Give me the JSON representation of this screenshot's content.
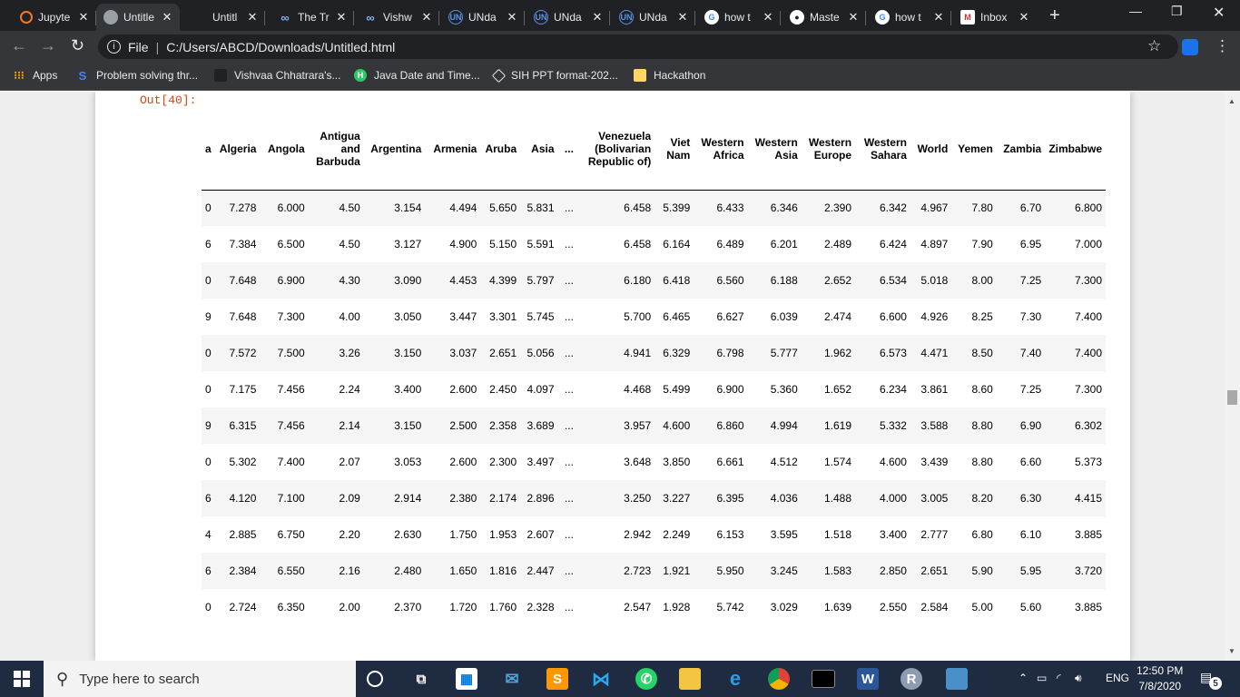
{
  "browser": {
    "tabs": [
      {
        "label": "Jupyte",
        "icon": "jupyter-icon",
        "active": false
      },
      {
        "label": "Untitle",
        "icon": "globe-icon",
        "active": true
      },
      {
        "label": "Untitl",
        "icon": "none",
        "active": false
      },
      {
        "label": "The Tr",
        "icon": "infinity-icon",
        "active": false
      },
      {
        "label": "Vishw",
        "icon": "infinity-icon",
        "active": false
      },
      {
        "label": "UNda",
        "icon": "un-icon",
        "active": false
      },
      {
        "label": "UNda",
        "icon": "un-icon",
        "active": false
      },
      {
        "label": "UNda",
        "icon": "un-icon",
        "active": false
      },
      {
        "label": "how t",
        "icon": "google-icon",
        "active": false
      },
      {
        "label": "Maste",
        "icon": "github-icon",
        "active": false
      },
      {
        "label": "how t",
        "icon": "google-icon",
        "active": false
      },
      {
        "label": "Inbox",
        "icon": "gmail-icon",
        "active": false
      }
    ],
    "address": {
      "scheme": "File",
      "path": "C:/Users/ABCD/Downloads/Untitled.html"
    },
    "bookmarks": [
      {
        "label": "Apps",
        "icon": "apps-grid-icon"
      },
      {
        "label": "Problem solving thr...",
        "icon": "s-logo-icon"
      },
      {
        "label": "Vishvaa Chhatrara's...",
        "icon": "none"
      },
      {
        "label": "Java Date and Time...",
        "icon": "h-logo-icon"
      },
      {
        "label": "SIH PPT format-202...",
        "icon": "sih-icon"
      },
      {
        "label": "Hackathon",
        "icon": "folder-icon"
      }
    ]
  },
  "notebook": {
    "out_prompt": "Out[40]:",
    "columns": [
      "a",
      "Algeria",
      "Angola",
      "Antigua and Barbuda",
      "Argentina",
      "Armenia",
      "Aruba",
      "Asia",
      "...",
      "Venezuela (Bolivarian Republic of)",
      "Viet Nam",
      "Western Africa",
      "Western Asia",
      "Western Europe",
      "Western Sahara",
      "World",
      "Yemen",
      "Zambia",
      "Zimbabwe"
    ],
    "rows": [
      [
        "0",
        "7.278",
        "6.000",
        "4.50",
        "3.154",
        "4.494",
        "5.650",
        "5.831",
        "...",
        "6.458",
        "5.399",
        "6.433",
        "6.346",
        "2.390",
        "6.342",
        "4.967",
        "7.80",
        "6.70",
        "6.800"
      ],
      [
        "6",
        "7.384",
        "6.500",
        "4.50",
        "3.127",
        "4.900",
        "5.150",
        "5.591",
        "...",
        "6.458",
        "6.164",
        "6.489",
        "6.201",
        "2.489",
        "6.424",
        "4.897",
        "7.90",
        "6.95",
        "7.000"
      ],
      [
        "0",
        "7.648",
        "6.900",
        "4.30",
        "3.090",
        "4.453",
        "4.399",
        "5.797",
        "...",
        "6.180",
        "6.418",
        "6.560",
        "6.188",
        "2.652",
        "6.534",
        "5.018",
        "8.00",
        "7.25",
        "7.300"
      ],
      [
        "9",
        "7.648",
        "7.300",
        "4.00",
        "3.050",
        "3.447",
        "3.301",
        "5.745",
        "...",
        "5.700",
        "6.465",
        "6.627",
        "6.039",
        "2.474",
        "6.600",
        "4.926",
        "8.25",
        "7.30",
        "7.400"
      ],
      [
        "0",
        "7.572",
        "7.500",
        "3.26",
        "3.150",
        "3.037",
        "2.651",
        "5.056",
        "...",
        "4.941",
        "6.329",
        "6.798",
        "5.777",
        "1.962",
        "6.573",
        "4.471",
        "8.50",
        "7.40",
        "7.400"
      ],
      [
        "0",
        "7.175",
        "7.456",
        "2.24",
        "3.400",
        "2.600",
        "2.450",
        "4.097",
        "...",
        "4.468",
        "5.499",
        "6.900",
        "5.360",
        "1.652",
        "6.234",
        "3.861",
        "8.60",
        "7.25",
        "7.300"
      ],
      [
        "9",
        "6.315",
        "7.456",
        "2.14",
        "3.150",
        "2.500",
        "2.358",
        "3.689",
        "...",
        "3.957",
        "4.600",
        "6.860",
        "4.994",
        "1.619",
        "5.332",
        "3.588",
        "8.80",
        "6.90",
        "6.302"
      ],
      [
        "0",
        "5.302",
        "7.400",
        "2.07",
        "3.053",
        "2.600",
        "2.300",
        "3.497",
        "...",
        "3.648",
        "3.850",
        "6.661",
        "4.512",
        "1.574",
        "4.600",
        "3.439",
        "8.80",
        "6.60",
        "5.373"
      ],
      [
        "6",
        "4.120",
        "7.100",
        "2.09",
        "2.914",
        "2.380",
        "2.174",
        "2.896",
        "...",
        "3.250",
        "3.227",
        "6.395",
        "4.036",
        "1.488",
        "4.000",
        "3.005",
        "8.20",
        "6.30",
        "4.415"
      ],
      [
        "4",
        "2.885",
        "6.750",
        "2.20",
        "2.630",
        "1.750",
        "1.953",
        "2.607",
        "...",
        "2.942",
        "2.249",
        "6.153",
        "3.595",
        "1.518",
        "3.400",
        "2.777",
        "6.80",
        "6.10",
        "3.885"
      ],
      [
        "6",
        "2.384",
        "6.550",
        "2.16",
        "2.480",
        "1.650",
        "1.816",
        "2.447",
        "...",
        "2.723",
        "1.921",
        "5.950",
        "3.245",
        "1.583",
        "2.850",
        "2.651",
        "5.90",
        "5.95",
        "3.720"
      ],
      [
        "0",
        "2.724",
        "6.350",
        "2.00",
        "2.370",
        "1.720",
        "1.760",
        "2.328",
        "...",
        "2.547",
        "1.928",
        "5.742",
        "3.029",
        "1.639",
        "2.550",
        "2.584",
        "5.00",
        "5.60",
        "3.885"
      ]
    ]
  },
  "taskbar": {
    "search_placeholder": "Type here to search",
    "apps": [
      "cortana-icon",
      "task-view-icon",
      "store-icon",
      "mail-icon",
      "sublime-icon",
      "vscode-icon",
      "whatsapp-icon",
      "explorer-icon",
      "edge-icon",
      "chrome-icon",
      "terminal-icon",
      "word-icon",
      "r-icon",
      "photos-icon"
    ],
    "lang": "ENG",
    "time": "12:50 PM",
    "date": "7/8/2020",
    "notifications": "5"
  },
  "colors": {
    "prompt": "#d84315",
    "tabstrip": "#202124",
    "toolbar": "#35363a",
    "taskbar": "#1f2b40"
  }
}
